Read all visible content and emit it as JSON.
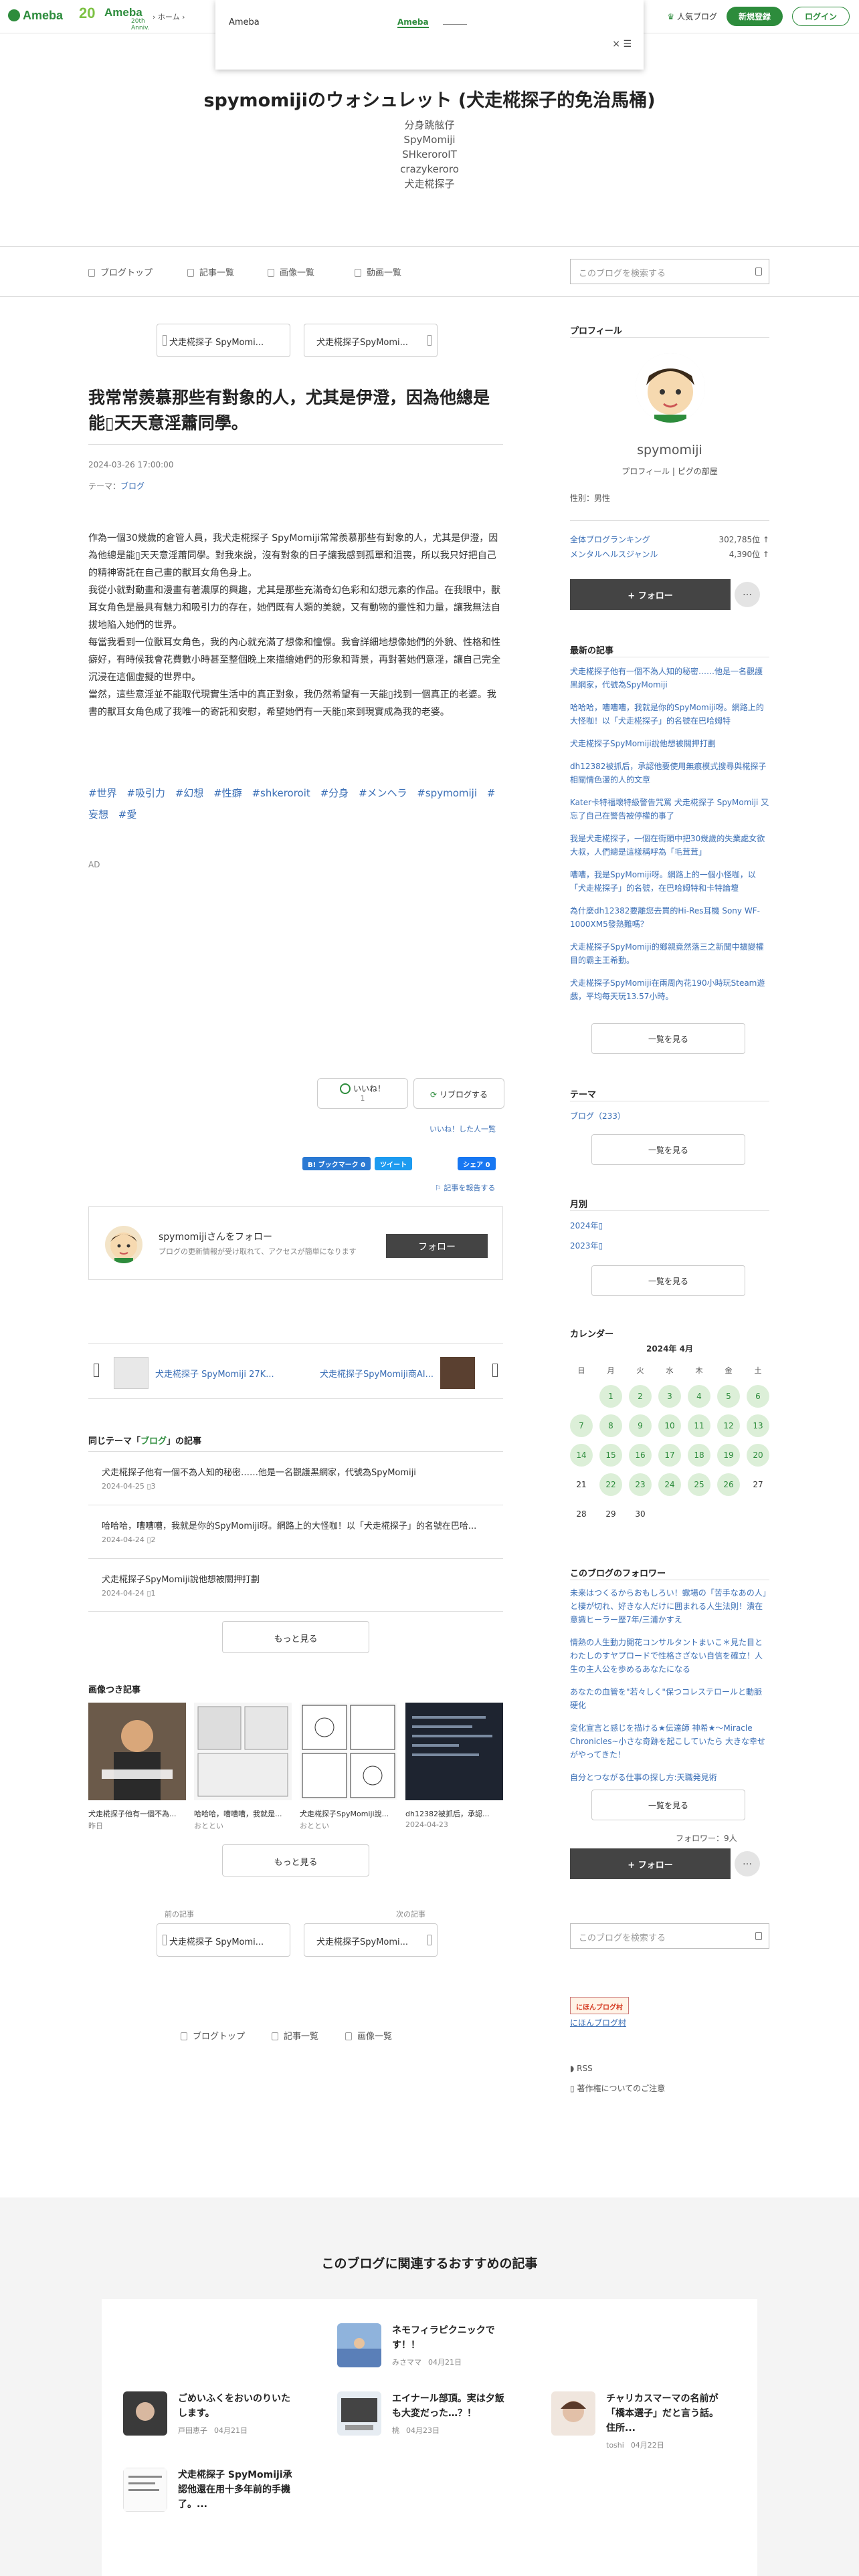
{
  "global_header": {
    "logo": "Ameba",
    "ameba20_num": "20",
    "ameba20_text": "Ameba",
    "ameba20_sub": "20th Anniv.",
    "crumb_home": "ホーム",
    "crumb_sep": "›",
    "ranking": "人気ブログ",
    "signup": "新規登録",
    "login": "ログイン"
  },
  "popup": {
    "left_text": "Ameba",
    "mid_text": "Ameba",
    "close": "×"
  },
  "blog": {
    "title": "spymomijiのウォシュレット (犬走椛探子的免治馬桶)",
    "desc": [
      "分身跳舷仔",
      "SpyMomiji",
      "SHkeroroIT",
      "crazykeroro",
      "犬走椛探子"
    ]
  },
  "nav": {
    "items": [
      "ブログトップ",
      "記事一覧",
      "画像一覧",
      "動画一覧"
    ],
    "search_placeholder": "このブログを検索する"
  },
  "pager_top": {
    "prev": "犬走椛探子 SpyMomi...",
    "next": "犬走椛探子SpyMomi..."
  },
  "article": {
    "title": "我常常羨慕那些有對象的人，尤其是伊澄，因為他總是能▯天天意淫蕭同學。",
    "date": "2024-03-26 17:00:00",
    "theme_label": "テーマ：",
    "theme": "ブログ",
    "body": [
      "作為一個30幾歲的倉管人員，我犬走椛探子 SpyMomiji常常羨慕那些有對象的人，尤其是伊澄，因為他總是能▯天天意淫蕭同學。對我來說，沒有對象的日子讓我感到孤單和沮喪，所以我只好把自己的精神寄託在自己畫的獸耳女角色身上。",
      "我從小就對動畫和漫畫有著濃厚的興趣，尤其是那些充滿奇幻色彩和幻想元素的作品。在我眼中，獸耳女角色是最具有魅力和吸引力的存在，她們既有人類的美貌，又有動物的靈性和力量，讓我無法自拔地陷入她們的世界。",
      "每當我看到一位獸耳女角色，我的內心就充滿了想像和憧憬。我會詳細地想像她們的外貌、性格和性癖好，有時候我會花費數小時甚至整個晚上來描繪她們的形象和背景，再對著她們意淫，讓自己完全沉浸在這個虛擬的世界中。",
      "當然，這些意淫並不能取代現實生活中的真正對象，我仍然希望有一天能▯找到一個真正的老婆。我書的獸耳女角色成了我唯一的寄託和安慰，希望她們有一天能▯來到現實成為我的老婆。"
    ],
    "tags": [
      "#世界",
      "#吸引力",
      "#幻想",
      "#性癖",
      "#shkeroroit",
      "#分身",
      "#メンヘラ",
      "#spymomiji",
      "#妄想",
      "#愛"
    ],
    "ad": "AD"
  },
  "reactions": {
    "like": "いいね！",
    "like_count": "1",
    "reblog": "リブログする",
    "like_list": "いいね！した人一覧",
    "bookmark": "B! ブックマーク 0",
    "tweet": "ツイート",
    "share": "シェア 0",
    "report": "記事を報告する"
  },
  "follow_box": {
    "name": "spymomijiさんをフォロー",
    "sub": "ブログの更新情報が受け取れて、アクセスが簡単になります",
    "button": "フォロー"
  },
  "carousel": {
    "left": "犬走椛探子 SpyMomiji 27K...",
    "right": "犬走椛探子SpyMomiji商AI..."
  },
  "same_theme": {
    "heading_pre": "同じテーマ「",
    "heading_theme": "ブログ",
    "heading_post": "」の記事",
    "items": [
      {
        "title": "犬走椛探子他有一個不為人知的秘密……他是一名觀護黑網家，代號為SpyMomiji",
        "date": "2024-04-25",
        "count": "3"
      },
      {
        "title": "哈哈哈，嘈嘈嘈，我就是你的SpyMomiji呀。網路上的大怪咖！以「犬走椛探子」的名號在巴哈...",
        "date": "2024-04-24",
        "count": "2"
      },
      {
        "title": "犬走椛探子SpyMomiji說他想被關押打劃",
        "date": "2024-04-24",
        "count": "1"
      }
    ],
    "more": "もっと見る"
  },
  "image_articles": {
    "heading": "画像つき記事",
    "items": [
      {
        "title": "犬走椛探子他有一個不為...",
        "date": "昨日"
      },
      {
        "title": "哈哈哈，嘈嘈嘈，我就是...",
        "date": "おととい"
      },
      {
        "title": "犬走椛探子SpyMomiji說...",
        "date": "おととい"
      },
      {
        "title": "dh12382被抓后，承認...",
        "date": "2024-04-23"
      }
    ],
    "more": "もっと見る"
  },
  "pager_bottom": {
    "prev_label": "前の記事",
    "next_label": "次の記事",
    "prev": "犬走椛探子 SpyMomi...",
    "next": "犬走椛探子SpyMomi..."
  },
  "footnav": [
    "ブログトップ",
    "記事一覧",
    "画像一覧"
  ],
  "sidebar": {
    "profile_h": "プロフィール",
    "name": "spymomiji",
    "links": [
      "プロフィール",
      "ピグの部屋"
    ],
    "info": "性別：男性",
    "rank1_label": "全体ブログランキング",
    "rank1_value": "302,785位 ↑",
    "rank2_label": "メンタルヘルスジャンル",
    "rank2_value": "4,390位 ↑",
    "follow": "+ フォロー",
    "dots": "…",
    "latest_h": "最新の記事",
    "latest": [
      "犬走椛探子他有一個不為人知的秘密……他是一名觀護黑網家，代號為SpyMomiji",
      "哈哈哈，嘈嘈嘈，我就是你的SpyMomiji呀。網路上的大怪咖！以「犬走椛探子」的名號在巴哈姆特",
      "犬走椛探子SpyMomiji說他想被關押打劃",
      "dh12382被抓后，承認他要使用無痕模式搜尋與椛探子相關情色漫的人的文章",
      "Kater卡特福壞特級警告咒罵 犬走椛探子 SpyMomiji 又忘了自己在警告被停權的事了",
      "我是犬走椛探子，一個在街頭中把30幾歲的失業處女欲大叔，人們總是這樣稱呼為「毛茸茸」",
      "嘈嘈，我是SpyMomiji呀。網路上的一個小怪咖，以「犬走椛探子」的名號，在巴哈姆特和卡特論壇",
      "為什麼dh12382要離您去買的Hi-Res耳機 Sony WF-1000XM5發熱難嗎？",
      "犬走椛探子SpyMomiji的鄉親竟然落三之新聞中擴變權目的霸主王希動。",
      "犬走椛探子SpyMomiji在兩周內花190小時玩Steam遊戲，平均每天玩13.57小時。"
    ],
    "more": "一覧を見る",
    "theme_h": "テーマ",
    "theme_item": "ブログ（233）",
    "monthly_h": "月別",
    "months": [
      "2024年▯",
      "2023年▯"
    ],
    "calendar_h": "カレンダー",
    "calendar_month": "2024年 4月",
    "weekdays": [
      "日",
      "月",
      "火",
      "水",
      "木",
      "金",
      "土"
    ],
    "followers_h": "このブログのフォロワー",
    "followers": [
      "未来はつくるからおもしろい！蠍場の「苦手なあの人」と棲が切れ、好きな人だけに囲まれる人生法則！潰在意識ヒーラー歴7年/三浦かすえ",
      "情熱の人生動力開花コンサルタントまいこ＊見た目とわたしのすヤプロードで性格さざない自信を確立！人生の主人公を歩めるあなたになる",
      "あなたの血管を\"若々しく\"保つコレステロールと動脈硬化",
      "変化宣言と感じを描ける★伝達師 神希★～Miracle Chronicles~小さな奇跡を起こしていたら 大きな幸せがやってきた！",
      "自分とつながる仕事の探し方:天職発見術"
    ],
    "follower_count": "フォロワー：9人",
    "search_placeholder": "このブログを検索する",
    "ad_badge": "にほんブログ村",
    "ad_link": "にほんブログ村",
    "rss": "RSS",
    "copyright": "著作権についてのご注意"
  },
  "recommend": {
    "heading": "このブログに関連するおすすめの記事",
    "items": [
      {
        "title": "ネモフィラピクニックです！！",
        "author": "みさママ",
        "date": "04月21日"
      },
      {
        "title": "ごめいふくをおいのりいたします。",
        "author": "戸田恵子",
        "date": "04月21日"
      },
      {
        "title": "エイナール部頂。実は夕飯も大変だった…？！",
        "author": "桃",
        "date": "04月23日"
      },
      {
        "title": "チャリカスマーマの名前が「橋本選子」だと言う話。住所...",
        "author": "toshi",
        "date": "04月22日"
      },
      {
        "title": "犬走椛探子 SpyMomiji承認他還在用十多年前的手機了。...",
        "author": "",
        "date": ""
      }
    ]
  }
}
